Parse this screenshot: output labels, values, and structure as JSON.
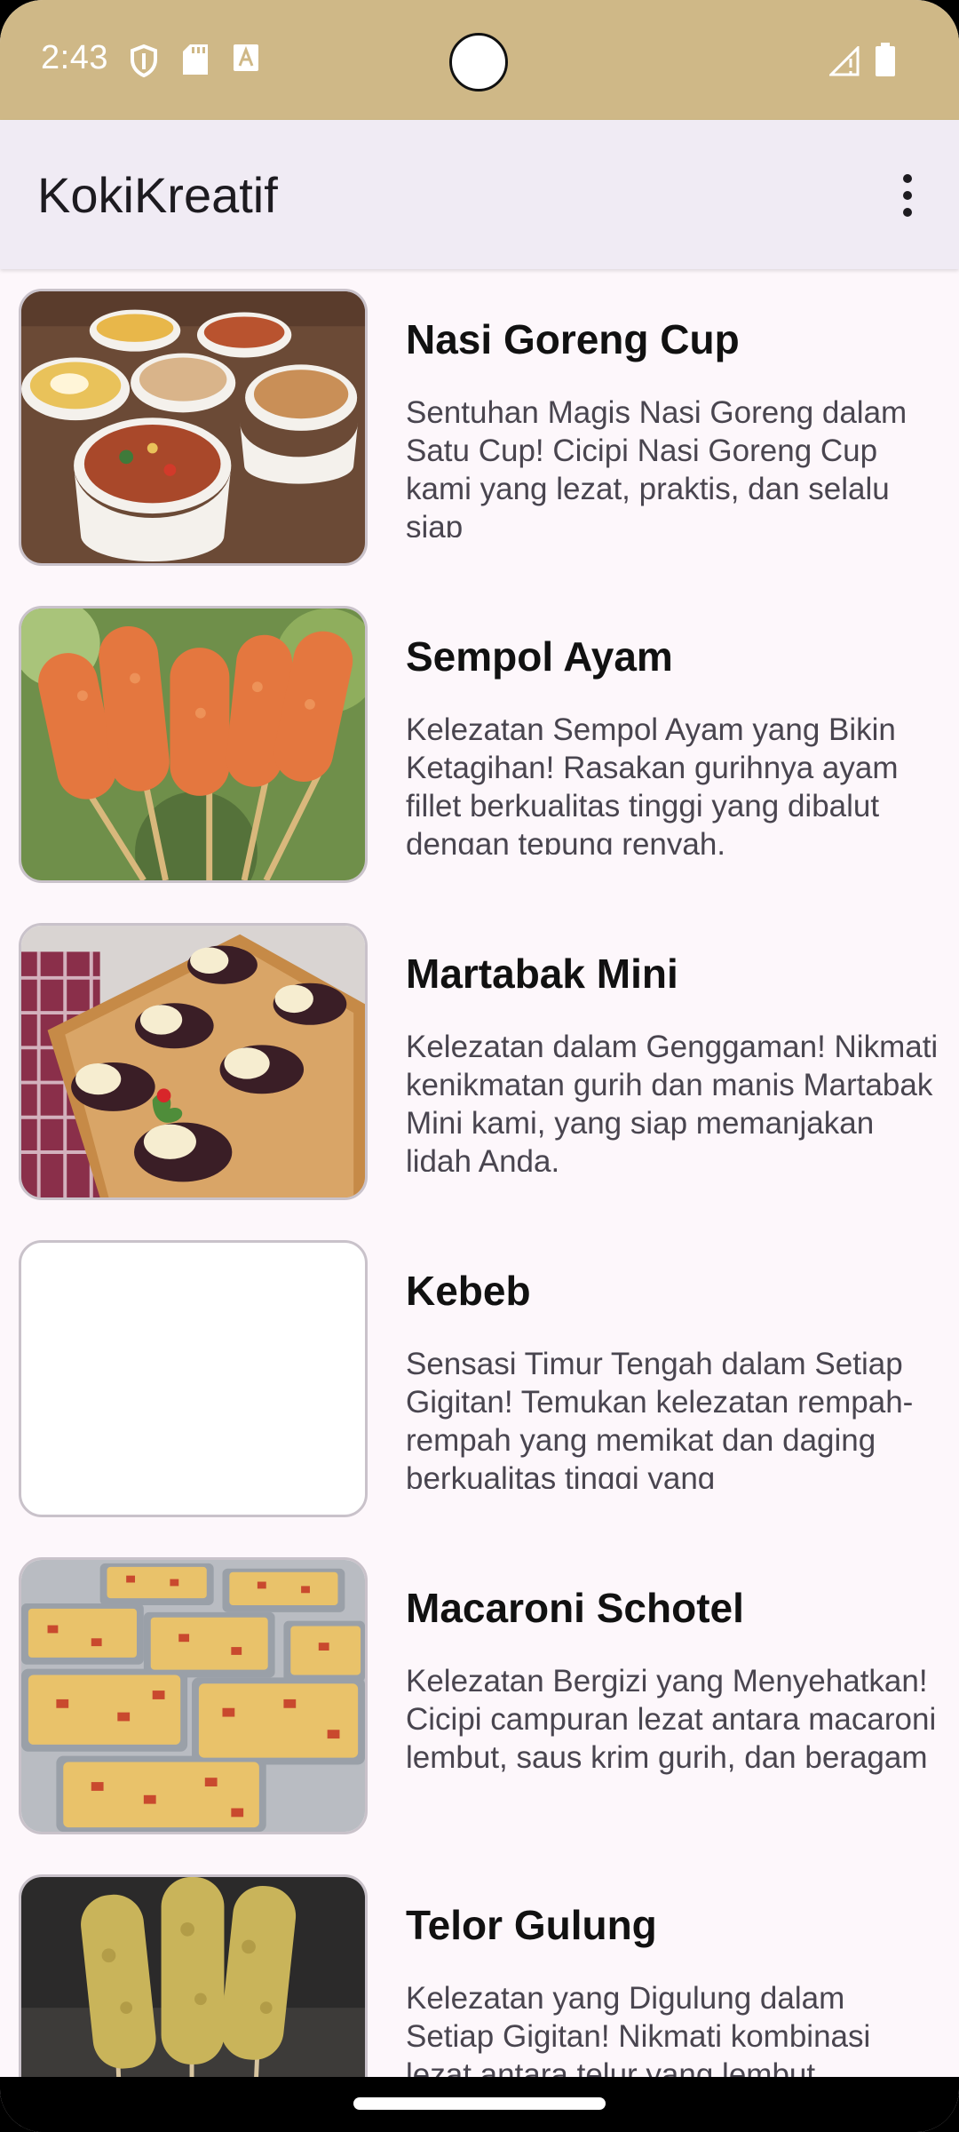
{
  "status_bar": {
    "time": "2:43",
    "icons": [
      "shield-icon",
      "sd-card-icon",
      "font-icon",
      "signal-icon",
      "battery-icon"
    ],
    "background": "#cfb887"
  },
  "app_bar": {
    "title": "KokiKreatif",
    "menu_icon": "more-vert-icon"
  },
  "recipes": [
    {
      "title": "Nasi Goreng Cup",
      "description": "Sentuhan Magis Nasi Goreng dalam Satu Cup! Cicipi Nasi Goreng Cup kami yang lezat, praktis, dan selalu siap",
      "image": "nasi-goreng-cup-photo"
    },
    {
      "title": "Sempol Ayam",
      "description": "Kelezatan Sempol Ayam yang Bikin Ketagihan! Rasakan gurihnya ayam fillet berkualitas tinggi yang dibalut dengan tepung renyah,",
      "image": "sempol-ayam-photo"
    },
    {
      "title": "Martabak Mini",
      "description": "Kelezatan dalam Genggaman! Nikmati kenikmatan gurih dan manis Martabak Mini kami, yang siap memanjakan lidah Anda.",
      "image": "martabak-mini-photo"
    },
    {
      "title": "Kebeb",
      "description": "Sensasi Timur Tengah dalam Setiap Gigitan! Temukan kelezatan rempah-rempah yang memikat dan daging berkualitas tinggi yang",
      "image": "empty-image"
    },
    {
      "title": "Macaroni Schotel",
      "description": "Kelezatan Bergizi yang Menyehatkan! Cicipi campuran lezat antara macaroni lembut, saus krim gurih, dan beragam",
      "image": "macaroni-schotel-photo"
    },
    {
      "title": "Telor Gulung",
      "description": "Kelezatan yang Digulung dalam Setiap Gigitan! Nikmati kombinasi lezat antara telur yang lembut",
      "image": "telor-gulung-photo"
    }
  ]
}
